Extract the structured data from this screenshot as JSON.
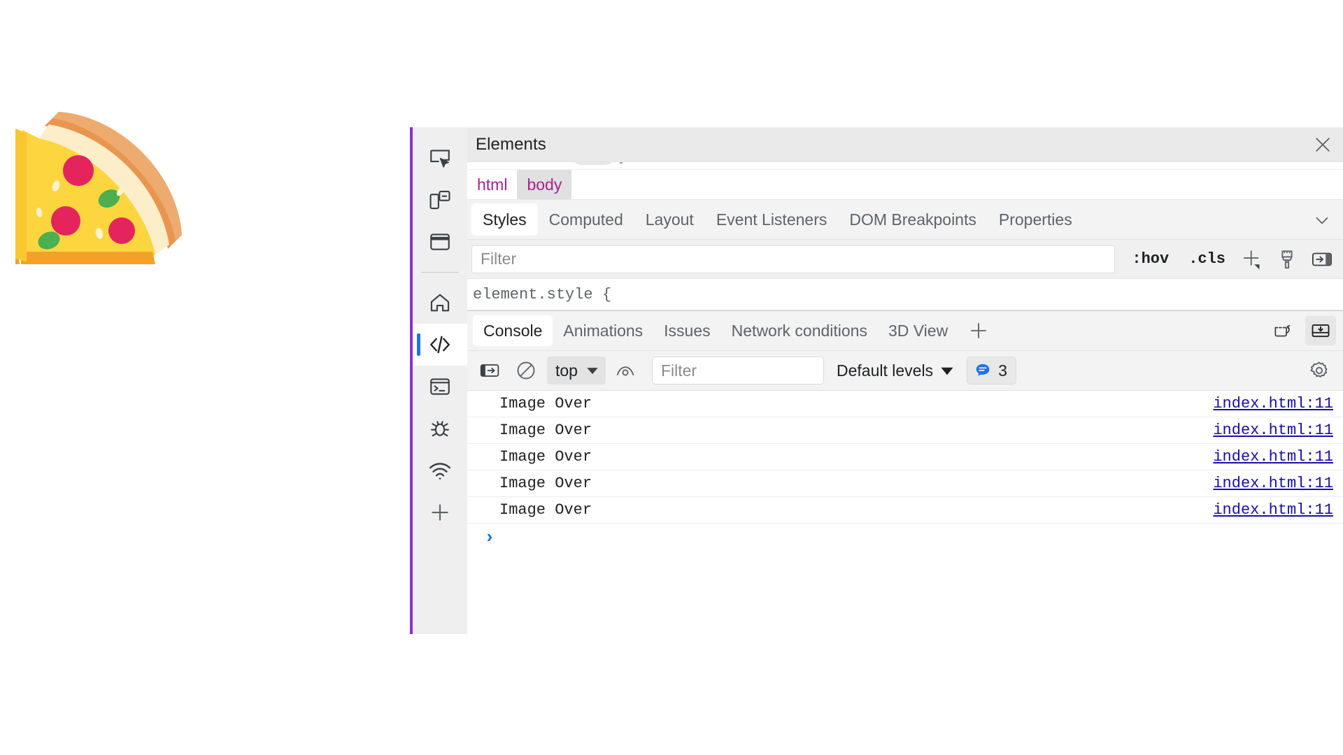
{
  "page": {
    "background": "#ffffff",
    "emoji": {
      "name": "pizza-slice-emoji",
      "alt": "pizza slice"
    }
  },
  "devtools": {
    "accent_color": "#8e2fd0",
    "title": "Elements",
    "close_label": "×",
    "activity_bar": {
      "items": [
        {
          "name": "inspect-element-icon",
          "label": "Inspect"
        },
        {
          "name": "device-emulation-icon",
          "label": "Device emulation"
        },
        {
          "name": "window-panel-icon",
          "label": "Panel"
        },
        {
          "name": "home-icon",
          "label": "Welcome"
        },
        {
          "name": "elements-code-icon",
          "label": "Elements",
          "selected": true
        },
        {
          "name": "console-terminal-icon",
          "label": "Console"
        },
        {
          "name": "debugger-bug-icon",
          "label": "Sources"
        },
        {
          "name": "network-wifi-icon",
          "label": "Network"
        },
        {
          "name": "add-tool-plus-icon",
          "label": "More tools"
        }
      ]
    },
    "breadcrumbs": [
      {
        "label": "html",
        "active": false
      },
      {
        "label": "body",
        "active": true
      }
    ],
    "styles_tabs": [
      {
        "label": "Styles",
        "active": true
      },
      {
        "label": "Computed",
        "active": false
      },
      {
        "label": "Layout",
        "active": false
      },
      {
        "label": "Event Listeners",
        "active": false
      },
      {
        "label": "DOM Breakpoints",
        "active": false
      },
      {
        "label": "Properties",
        "active": false
      }
    ],
    "styles_more_icon": "chevron-down-icon",
    "styles_filter": {
      "value": "",
      "placeholder": "Filter"
    },
    "styles_toolbar": {
      "hov_label": ":hov",
      "cls_label": ".cls",
      "new_rule_icon": "plus-dropdown-icon",
      "color_picker_icon": "paintbrush-icon",
      "sidebar_toggle_icon": "panel-toggle-icon"
    },
    "element_style_rule": "element.style {"
  },
  "drawer": {
    "tabs": [
      {
        "label": "Console",
        "active": true
      },
      {
        "label": "Animations",
        "active": false
      },
      {
        "label": "Issues",
        "active": false
      },
      {
        "label": "Network conditions",
        "active": false
      },
      {
        "label": "3D View",
        "active": false
      }
    ],
    "add_tab_icon": "plus-icon",
    "actions": [
      {
        "name": "restore-drawer-icon",
        "pressed": false
      },
      {
        "name": "dock-to-bottom-icon",
        "pressed": true
      }
    ],
    "console_toolbar": {
      "sidebar_toggle_icon": "console-sidebar-icon",
      "clear_console_icon": "clear-console-icon",
      "context_selector": {
        "value": "top",
        "chevron": "chevron-down-icon"
      },
      "live_expression_icon": "eye-icon",
      "filter": {
        "value": "",
        "placeholder": "Filter"
      },
      "levels": {
        "label": "Default levels",
        "chevron": "chevron-down-icon"
      },
      "message_badge": {
        "icon": "message-bubble-icon",
        "count": "3",
        "color": "#1a73e8"
      },
      "settings_icon": "gear-icon"
    },
    "messages": [
      {
        "text": "Image Over",
        "source": "index.html:11"
      },
      {
        "text": "Image Over",
        "source": "index.html:11"
      },
      {
        "text": "Image Over",
        "source": "index.html:11"
      },
      {
        "text": "Image Over",
        "source": "index.html:11"
      },
      {
        "text": "Image Over",
        "source": "index.html:11"
      }
    ],
    "prompt_caret": "›"
  }
}
